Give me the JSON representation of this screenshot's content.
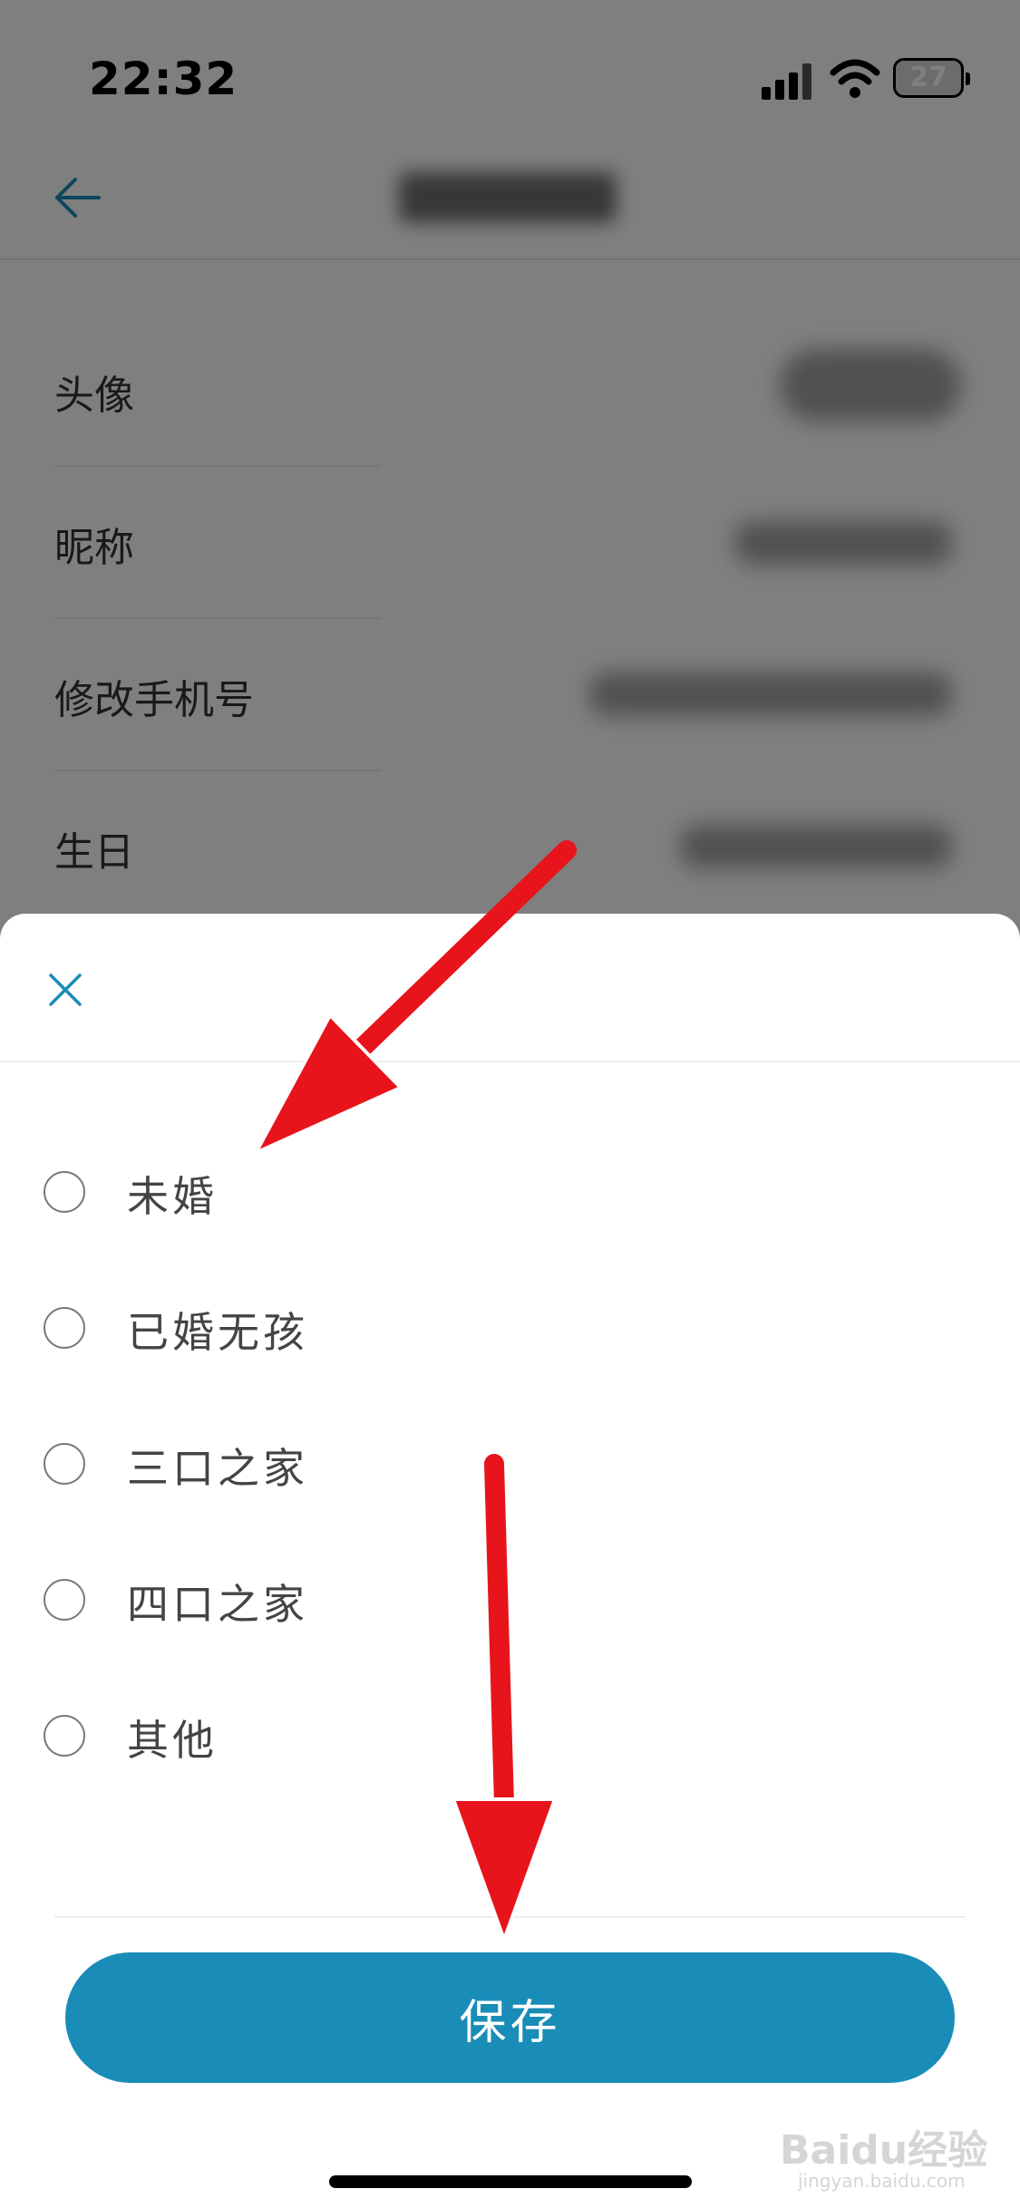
{
  "status_bar": {
    "time": "22:32",
    "battery": "27"
  },
  "rows": [
    {
      "label": "头像"
    },
    {
      "label": "昵称"
    },
    {
      "label": "修改手机号"
    },
    {
      "label": "生日"
    }
  ],
  "sheet": {
    "options": [
      {
        "label": "未婚",
        "selected": false
      },
      {
        "label": "已婚无孩",
        "selected": false
      },
      {
        "label": "三口之家",
        "selected": false
      },
      {
        "label": "四口之家",
        "selected": false
      },
      {
        "label": "其他",
        "selected": false
      }
    ],
    "save_label": "保存"
  },
  "watermark": {
    "main": "Baidu经验",
    "sub": "jingyan.baidu.com"
  },
  "colors": {
    "accent": "#1a8cb8",
    "arrow": "#e8141b"
  },
  "icons": [
    "back-arrow-icon",
    "close-icon",
    "signal-icon",
    "wifi-icon",
    "battery-icon",
    "radio-icon"
  ]
}
